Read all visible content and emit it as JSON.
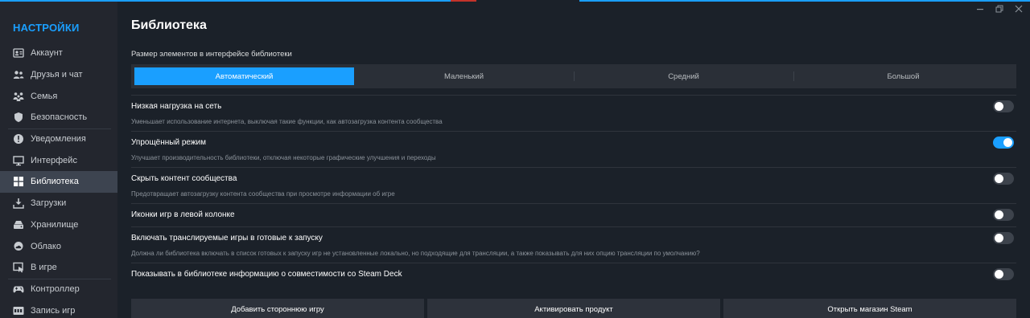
{
  "sidebar": {
    "title": "НАСТРОЙКИ",
    "items": [
      {
        "label": "Аккаунт",
        "icon": "account-card-icon"
      },
      {
        "label": "Друзья и чат",
        "icon": "friends-icon"
      },
      {
        "label": "Семья",
        "icon": "family-icon"
      },
      {
        "label": "Безопасность",
        "icon": "shield-icon"
      },
      {
        "label": "Уведомления",
        "icon": "alert-icon"
      },
      {
        "label": "Интерфейс",
        "icon": "monitor-icon"
      },
      {
        "label": "Библиотека",
        "icon": "grid-icon"
      },
      {
        "label": "Загрузки",
        "icon": "download-icon"
      },
      {
        "label": "Хранилище",
        "icon": "storage-icon"
      },
      {
        "label": "Облако",
        "icon": "cloud-icon"
      },
      {
        "label": "В игре",
        "icon": "in-game-icon"
      },
      {
        "label": "Контроллер",
        "icon": "gamepad-icon"
      },
      {
        "label": "Запись игр",
        "icon": "rec-icon"
      }
    ]
  },
  "page": {
    "title": "Библиотека"
  },
  "size": {
    "label": "Размер элементов в интерфейсе библиотеки",
    "options": [
      "Автоматический",
      "Маленький",
      "Средний",
      "Большой"
    ],
    "selected": "Автоматический"
  },
  "settings": [
    {
      "name": "Низкая нагрузка на сеть",
      "desc": "Уменьшает использование интернета, выключая такие функции, как автозагрузка контента сообщества",
      "on": false
    },
    {
      "name": "Упрощённый режим",
      "desc": "Улучшает производительность библиотеки, отключая некоторые графические улучшения и переходы",
      "on": true
    },
    {
      "name": "Скрыть контент сообщества",
      "desc": "Предотвращает автозагрузку контента сообщества при просмотре информации об игре",
      "on": false
    },
    {
      "name": "Иконки игр в левой колонке",
      "desc": "",
      "on": false
    },
    {
      "name": "Включать транслируемые игры в готовые к запуску",
      "desc": "Должна ли библиотека включать в список готовых к запуску игр не установленные локально, но подходящие для трансляции, а также показывать для них опцию трансляции по умолчанию?",
      "on": false
    },
    {
      "name": "Показывать в библиотеке информацию о совместимости со Steam Deck",
      "desc": "",
      "on": false
    }
  ],
  "buttons": {
    "add_game": "Добавить стороннюю игру",
    "activate": "Активировать продукт",
    "open_store": "Открыть магазин Steam"
  },
  "colors": {
    "accent": "#1a9fff",
    "background": "#1b2129",
    "sidebar": "#23262e",
    "active_item": "#3d4450"
  }
}
